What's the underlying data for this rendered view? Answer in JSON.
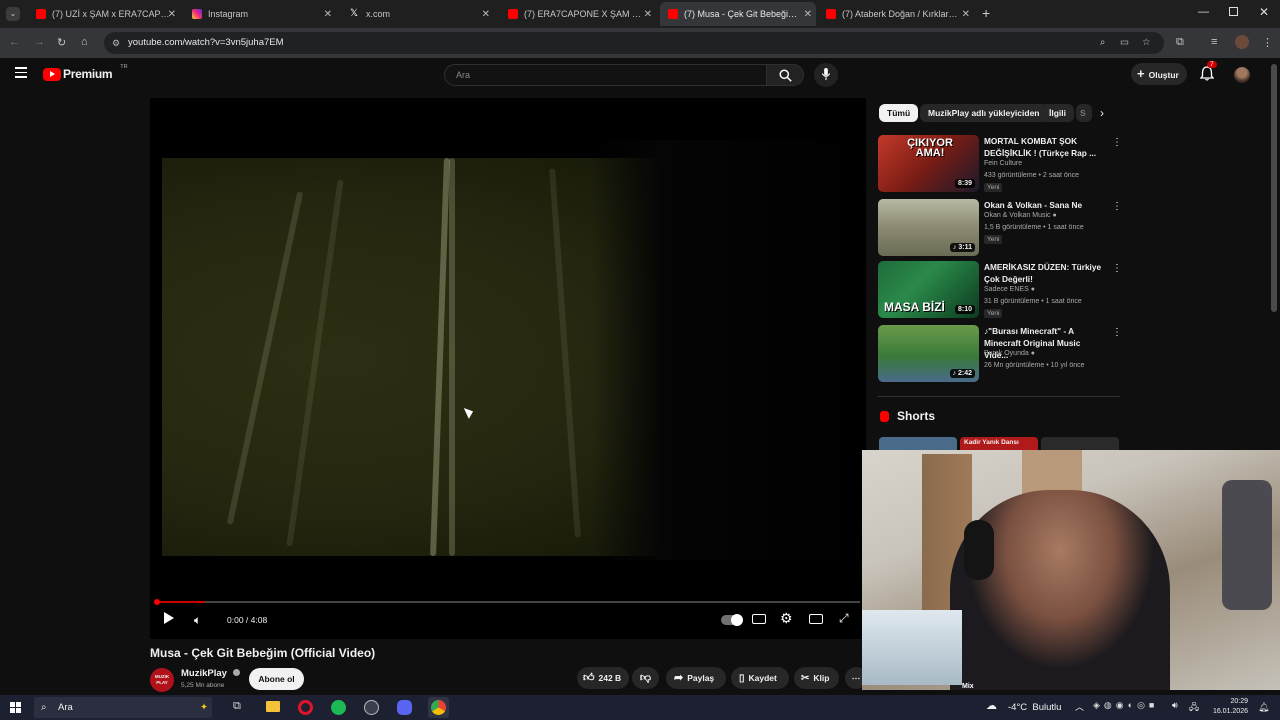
{
  "browser": {
    "tabs": [
      {
        "title": "(7) UZİ x ŞAM x ERA7CAPONE",
        "active": false,
        "favicon": "youtube-icon"
      },
      {
        "title": "Instagram",
        "active": false,
        "favicon": "instagram-icon"
      },
      {
        "title": "x.com",
        "active": false,
        "favicon": "x-icon"
      },
      {
        "title": "(7) ERA7CAPONE X ŞAM - BAN",
        "active": false,
        "favicon": "youtube-icon"
      },
      {
        "title": "(7) Musa - Çek Git Bebeğim (Of",
        "active": true,
        "favicon": "youtube-icon"
      },
      {
        "title": "(7) Ataberk Doğan / Kırklareli -",
        "active": false,
        "favicon": "youtube-icon"
      }
    ],
    "url": "youtube.com/watch?v=3vn5juha7EM"
  },
  "youtube": {
    "logo_text": "Premium",
    "logo_badge": "TR",
    "search_placeholder": "Ara",
    "create_label": "Oluştur",
    "notif_count": "7",
    "video": {
      "title": "Musa - Çek Git Bebeğim (Official Video)",
      "time_current": "0:00",
      "time_total": "4:08",
      "time_display": "0:00 / 4:08",
      "progress": 0.07
    },
    "channel": {
      "name": "MuzikPlay",
      "subs": "5,25 Mn abone",
      "subscribe_label": "Abone ol",
      "avatar_text": "MUZIK PLAY"
    },
    "actions": {
      "likes": "242 B",
      "share": "Paylaş",
      "save": "Kaydet",
      "clip": "Klip"
    },
    "chips": [
      "Tümü",
      "MuzikPlay adlı yükleyiciden",
      "İlgili",
      "S"
    ],
    "recommendations": [
      {
        "title": "MORTAL KOMBAT ŞOK DEĞİŞİKLİK ! (Türkçe Rap ...",
        "channel": "Fein Culture",
        "meta": "433 görüntüleme • 2 saat önce",
        "badge": "Yeni",
        "duration": "8:39",
        "thumb_text": "ÇIKIYOR AMA!",
        "verified": false,
        "music": false
      },
      {
        "title": "Okan & Volkan - Sana Ne",
        "channel": "Okan & Volkan Music",
        "meta": "1,5 B görüntüleme • 1 saat önce",
        "badge": "Yeni",
        "duration": "3:11",
        "thumb_text": "",
        "verified": true,
        "music": true
      },
      {
        "title": "AMERİKASIZ DÜZEN: Türkiye Çok Değerli!",
        "channel": "Sadece ENES",
        "meta": "31 B görüntüleme • 1 saat önce",
        "badge": "Yeni",
        "duration": "8:10",
        "thumb_text": "MASA BİZİ",
        "verified": true,
        "music": false
      },
      {
        "title": "♪\"Burası Minecraft\" - A Minecraft Original Music Vide...",
        "channel": "Burak Oyunda",
        "meta": "26 Mn görüntüleme • 10 yıl önce",
        "badge": "",
        "duration": "2:42",
        "thumb_text": "",
        "verified": true,
        "music": true
      }
    ],
    "shorts_label": "Shorts",
    "shorts_preview_text": "Kadir Yanık Dansı",
    "mix_label": "Mix"
  },
  "taskbar": {
    "search_placeholder": "Ara",
    "weather": "-4°C  Bulutlu",
    "time": "20:29",
    "date": "16.01.2026"
  },
  "colors": {
    "yt_red": "#ff0000",
    "background": "#0f0f0f",
    "chip": "#272727"
  }
}
